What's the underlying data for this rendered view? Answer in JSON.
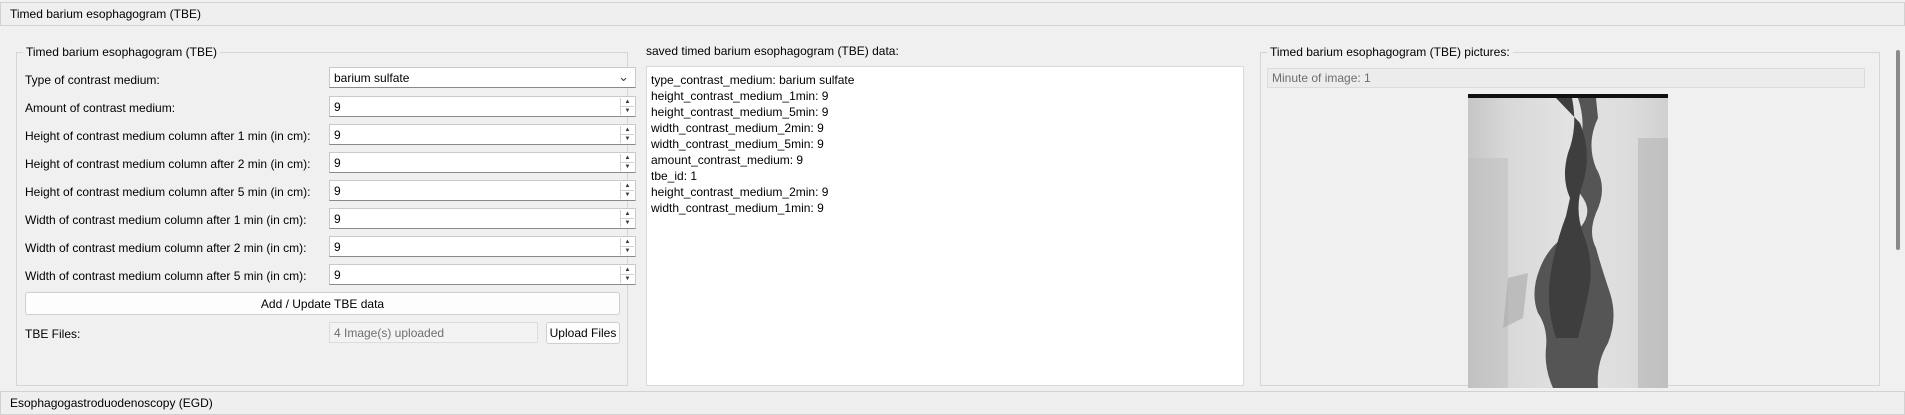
{
  "sections": {
    "tbe_header": "Timed barium esophagogram (TBE)",
    "egd_header": "Esophagogastroduodenoscopy (EGD)"
  },
  "form": {
    "group_title": "Timed barium esophagogram (TBE)",
    "type_label": "Type of contrast medium:",
    "type_value": "barium sulfate",
    "amount_label": "Amount of contrast medium:",
    "amount_value": "9",
    "h1_label": "Height of contrast medium column after 1 min (in cm):",
    "h1_value": "9",
    "h2_label": "Height of contrast medium column after 2 min (in cm):",
    "h2_value": "9",
    "h5_label": "Height of contrast medium column after 5 min (in cm):",
    "h5_value": "9",
    "w1_label": "Width of contrast medium column after 1 min (in cm):",
    "w1_value": "9",
    "w2_label": "Width of contrast medium column after 2 min (in cm):",
    "w2_value": "9",
    "w5_label": "Width of contrast medium column after 5 min (in cm):",
    "w5_value": "9",
    "add_update_button": "Add / Update TBE data",
    "files_label": "TBE Files:",
    "files_status": "4 Image(s) uploaded",
    "upload_button": "Upload Files"
  },
  "saved": {
    "group_title": "saved timed barium esophagogram (TBE) data:",
    "lines": [
      "type_contrast_medium: barium sulfate",
      "height_contrast_medium_1min: 9",
      "height_contrast_medium_5min: 9",
      "width_contrast_medium_2min: 9",
      "width_contrast_medium_5min: 9",
      "amount_contrast_medium: 9",
      "tbe_id: 1",
      "height_contrast_medium_2min: 9",
      "width_contrast_medium_1min: 9"
    ]
  },
  "pictures": {
    "group_title": "Timed barium esophagogram (TBE) pictures:",
    "minute_label": "Minute of image: 1"
  },
  "icons": {
    "dropdown": "chevron-down-icon",
    "spin_up": "spin-up-icon",
    "spin_down": "spin-down-icon"
  }
}
